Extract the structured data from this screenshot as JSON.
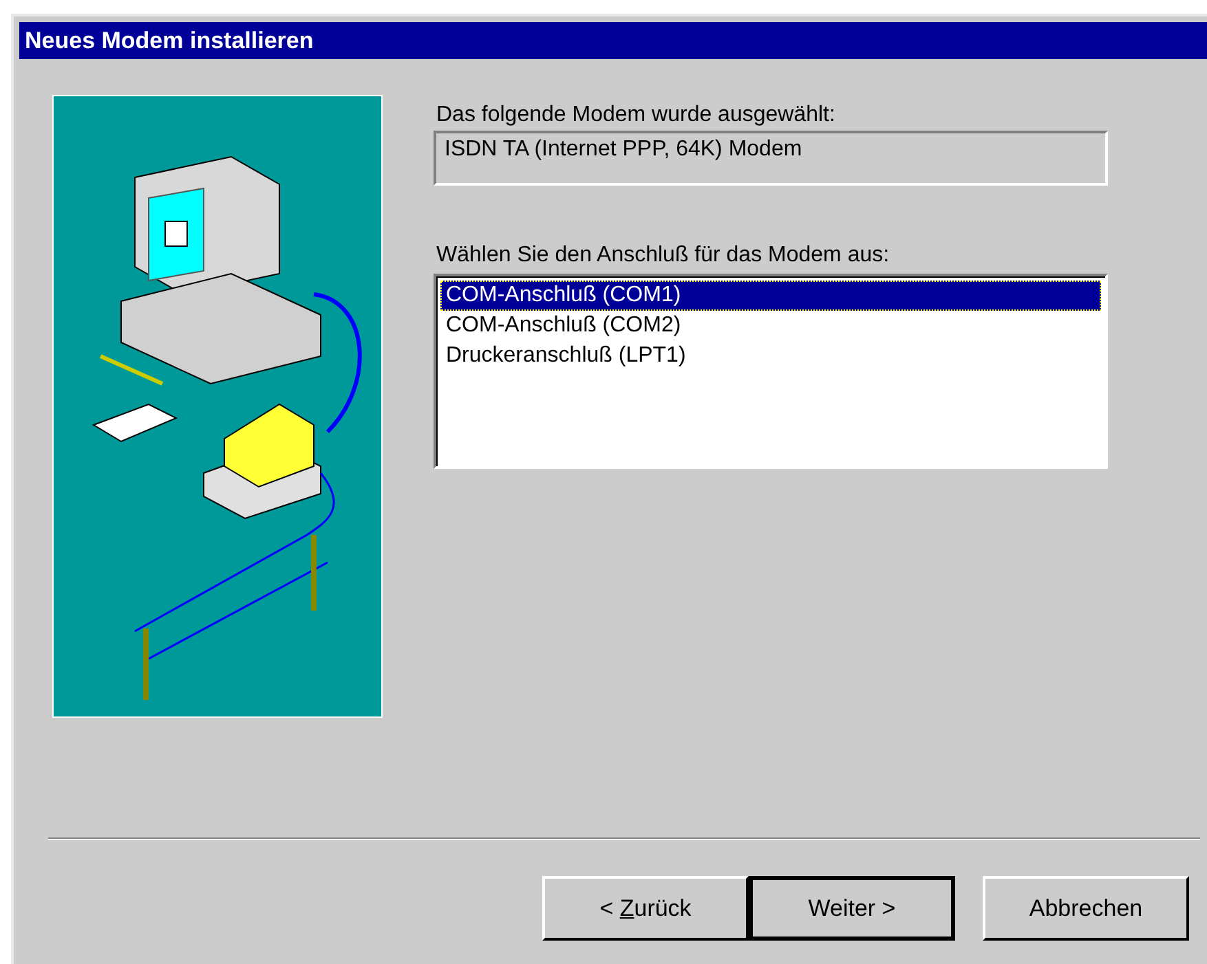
{
  "window": {
    "title": "Neues Modem installieren"
  },
  "selected_modem": {
    "label": "Das folgende Modem wurde ausgewählt:",
    "value": "ISDN TA (Internet PPP, 64K) Modem"
  },
  "port_list": {
    "label": "Wählen Sie den Anschluß für das Modem aus:",
    "items": [
      {
        "label": "COM-Anschluß (COM1)",
        "selected": true
      },
      {
        "label": "COM-Anschluß (COM2)",
        "selected": false
      },
      {
        "label": "Druckeranschluß (LPT1)",
        "selected": false
      }
    ]
  },
  "buttons": [
    {
      "prefix": "< ",
      "mnemonic": "Z",
      "rest": "urück",
      "default": false
    },
    {
      "prefix": "Weiter >",
      "default": true
    },
    {
      "prefix": "Abbrechen",
      "default": false
    }
  ]
}
